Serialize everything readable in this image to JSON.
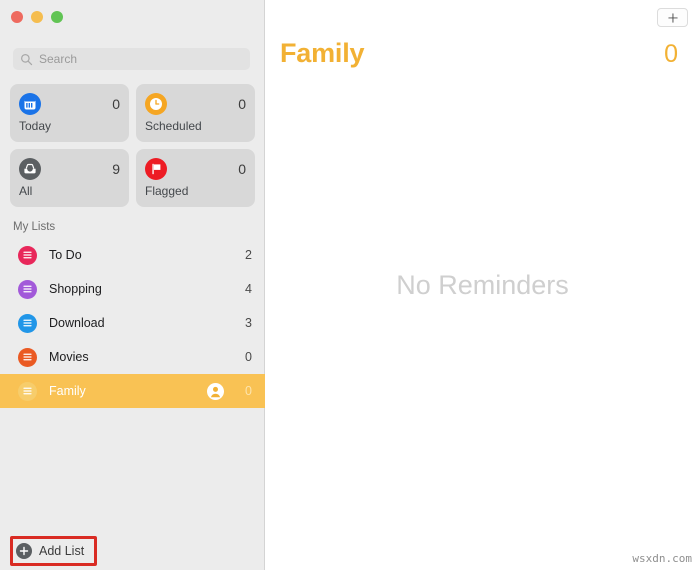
{
  "window": {
    "traffic_lights": [
      {
        "name": "close",
        "color": "#ee6a5f"
      },
      {
        "name": "minimize",
        "color": "#f5bd4f"
      },
      {
        "name": "maximize",
        "color": "#61c454"
      }
    ]
  },
  "sidebar": {
    "search": {
      "placeholder": "Search",
      "value": "",
      "icon": "search-icon"
    },
    "smart_lists": [
      {
        "id": "today",
        "label": "Today",
        "count": "0",
        "icon": "calendar-icon",
        "color": "#1a73e8"
      },
      {
        "id": "scheduled",
        "label": "Scheduled",
        "count": "0",
        "icon": "clock-icon",
        "color": "#f5a623"
      },
      {
        "id": "all",
        "label": "All",
        "count": "9",
        "icon": "inbox-icon",
        "color": "#5b5f62"
      },
      {
        "id": "flagged",
        "label": "Flagged",
        "count": "0",
        "icon": "flag-icon",
        "color": "#ed1c24"
      }
    ],
    "my_lists_header": "My Lists",
    "lists": [
      {
        "id": "todo",
        "label": "To Do",
        "count": "2",
        "color": "#e8275a",
        "selected": false,
        "shared": false
      },
      {
        "id": "shopping",
        "label": "Shopping",
        "count": "4",
        "color": "#a259d9",
        "selected": false,
        "shared": false
      },
      {
        "id": "download",
        "label": "Download",
        "count": "3",
        "color": "#2196e8",
        "selected": false,
        "shared": false
      },
      {
        "id": "movies",
        "label": "Movies",
        "count": "0",
        "color": "#ea5a23",
        "selected": false,
        "shared": false
      },
      {
        "id": "family",
        "label": "Family",
        "count": "0",
        "color": "#f2b134",
        "selected": true,
        "shared": true
      }
    ],
    "add_list": {
      "label": "Add List",
      "icon": "plus-circle-icon",
      "highlight_color": "#d92b23"
    }
  },
  "main": {
    "add_reminder_icon": "plus-icon",
    "title": "Family",
    "count": "0",
    "empty_message": "No Reminders",
    "accent_color": "#f2b134"
  },
  "watermark": "wsxdn.com"
}
